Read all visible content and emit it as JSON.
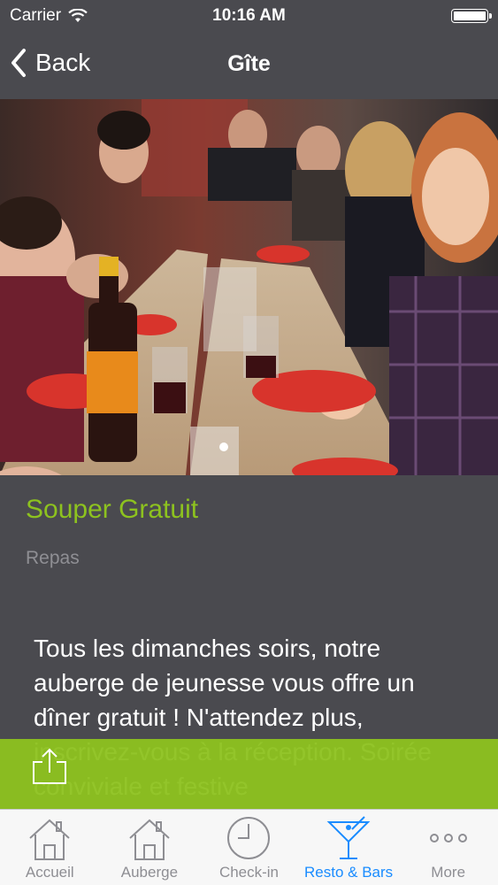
{
  "status_bar": {
    "carrier": "Carrier",
    "time": "10:16 AM",
    "wifi_icon": "wifi-icon",
    "battery_icon": "battery-icon"
  },
  "nav": {
    "back_label": "Back",
    "back_icon": "chevron-left-icon",
    "title": "Gîte"
  },
  "hero": {
    "image": "photo of people dining at a long table",
    "page_indicator_current": 1
  },
  "item": {
    "title": "Souper Gratuit",
    "category": "Repas",
    "description": "Tous les dimanches soirs, notre auberge de jeunesse vous offre un dîner gratuit ! N'attendez plus, inscrivez-vous à la réception. Soirée conviviale et festive"
  },
  "share": {
    "icon": "share-icon"
  },
  "tabs": [
    {
      "label": "Accueil",
      "icon": "house-icon",
      "active": false
    },
    {
      "label": "Auberge",
      "icon": "house-icon",
      "active": false
    },
    {
      "label": "Check-in",
      "icon": "clock-icon",
      "active": false
    },
    {
      "label": "Resto & Bars",
      "icon": "cocktail-glass-icon",
      "active": true
    },
    {
      "label": "More",
      "icon": "more-dots-icon",
      "active": false
    }
  ],
  "colors": {
    "accent_green": "#8dc21f",
    "active_tab_blue": "#1a8cff",
    "bar_gray": "#4a4a4f"
  }
}
